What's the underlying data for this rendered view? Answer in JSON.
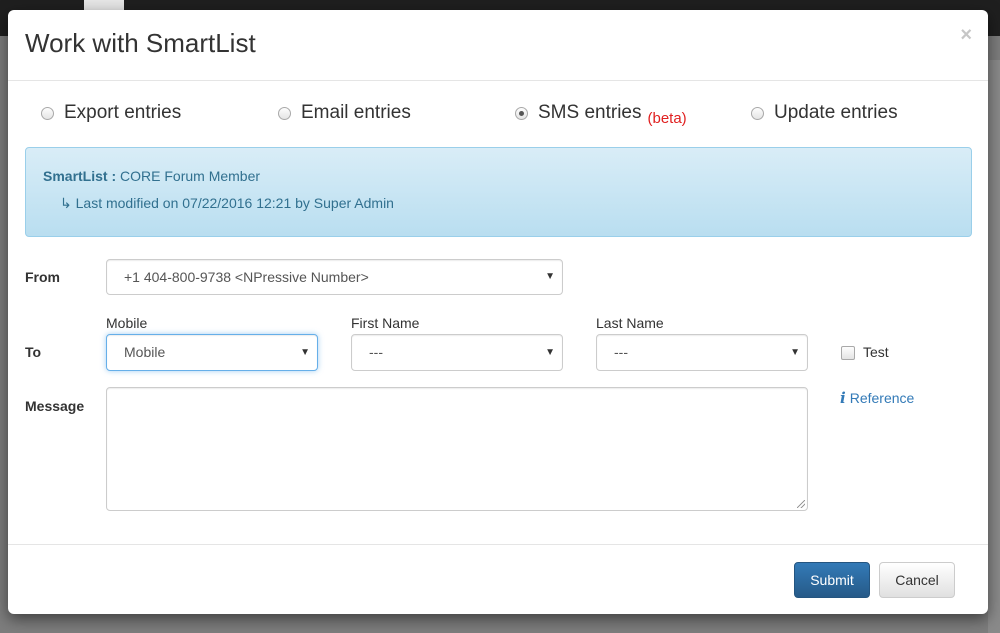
{
  "modal": {
    "title": "Work with SmartList",
    "close_glyph": "×"
  },
  "actions": [
    {
      "label": "Export entries",
      "checked": false
    },
    {
      "label": "Email entries",
      "checked": false
    },
    {
      "label": "SMS entries",
      "checked": true,
      "badge": "(beta)"
    },
    {
      "label": "Update entries",
      "checked": false
    }
  ],
  "info_box": {
    "smartlist_label": "SmartList :",
    "smartlist_name": "CORE Forum Member",
    "modified_arrow": "↳",
    "modified_text": "Last modified on 07/22/2016 12:21 by Super Admin"
  },
  "form": {
    "from_label": "From",
    "from_value": "+1 404-800-9738 <NPressive Number>",
    "to_label": "To",
    "mobile_label": "Mobile",
    "mobile_value": "Mobile",
    "first_name_label": "First Name",
    "first_name_value": "---",
    "last_name_label": "Last Name",
    "last_name_value": "---",
    "test_label": "Test",
    "test_checked": false,
    "message_label": "Message",
    "message_value": "",
    "reference_label": "Reference",
    "reference_icon": "info-icon"
  },
  "footer": {
    "submit_label": "Submit",
    "cancel_label": "Cancel"
  },
  "colors": {
    "primary": "#337ab7",
    "alert_text": "#31708f",
    "beta": "#e02020"
  }
}
